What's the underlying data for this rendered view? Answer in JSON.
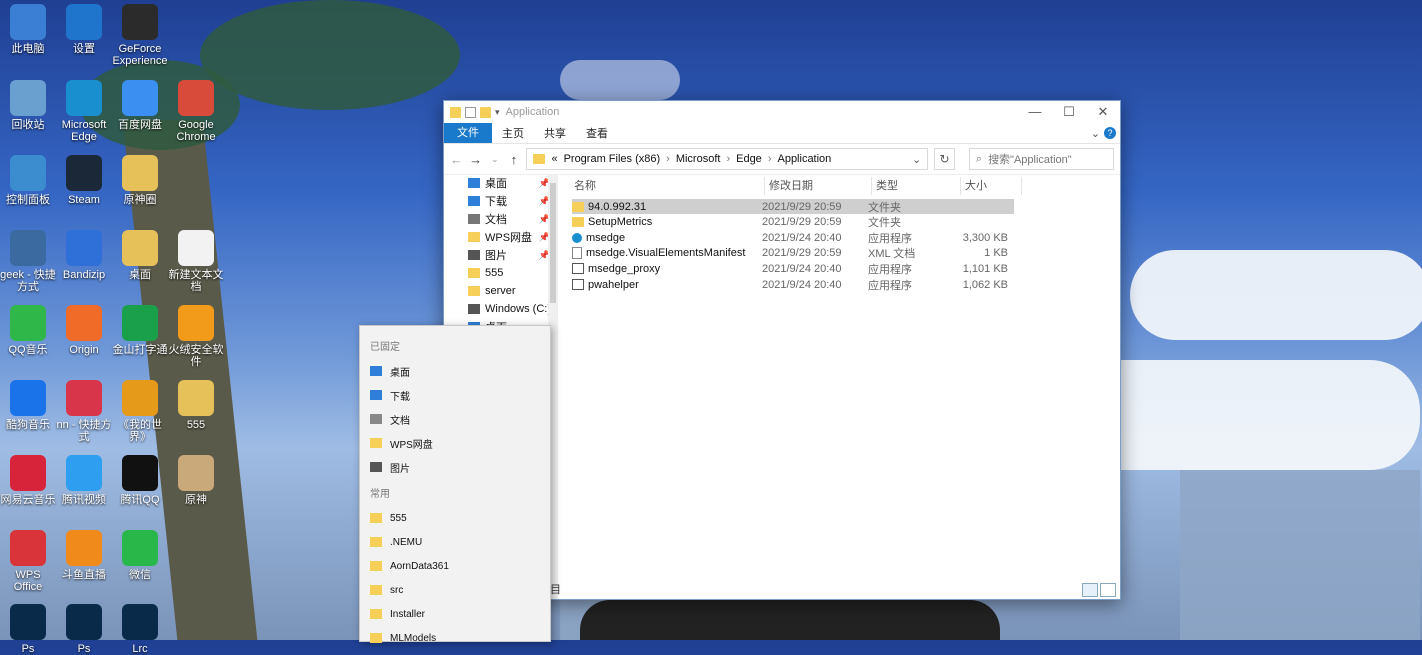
{
  "desktop": {
    "icons": [
      {
        "label": "此电脑",
        "color": "#3b7fd4"
      },
      {
        "label": "设置",
        "color": "#1f75cc"
      },
      {
        "label": "GeForce Experience",
        "color": "#2b2b2b"
      },
      {
        "label": "回收站",
        "color": "#6aa0d0"
      },
      {
        "label": "Microsoft Edge",
        "color": "#1a8fd0"
      },
      {
        "label": "百度网盘",
        "color": "#3b8ff0"
      },
      {
        "label": "Google Chrome",
        "color": "#d84a3a"
      },
      {
        "label": "控制面板",
        "color": "#3c8dcf"
      },
      {
        "label": "Steam",
        "color": "#1b2838"
      },
      {
        "label": "原神圈",
        "color": "#e6c15a"
      },
      {
        "label": "geek - 快捷方式",
        "color": "#3a6aa0"
      },
      {
        "label": "Bandizip",
        "color": "#2f6fd8"
      },
      {
        "label": "桌面",
        "color": "#e6c15a"
      },
      {
        "label": "新建文本文档",
        "color": "#f2f2f2"
      },
      {
        "label": "QQ音乐",
        "color": "#2fb74a"
      },
      {
        "label": "Origin",
        "color": "#f06a28"
      },
      {
        "label": "金山打字通",
        "color": "#1aa04a"
      },
      {
        "label": "火绒安全软件",
        "color": "#f29a1a"
      },
      {
        "label": "酷狗音乐",
        "color": "#1a73e8"
      },
      {
        "label": "nn - 快捷方式",
        "color": "#d8344a"
      },
      {
        "label": "《我的世界》",
        "color": "#e69a1a"
      },
      {
        "label": "555",
        "color": "#e6c15a"
      },
      {
        "label": "网易云音乐",
        "color": "#d8243a"
      },
      {
        "label": "腾讯视频",
        "color": "#2e9ef0"
      },
      {
        "label": "腾讯QQ",
        "color": "#111111"
      },
      {
        "label": "原神",
        "color": "#c9a87a"
      },
      {
        "label": "WPS Office",
        "color": "#d8343a"
      },
      {
        "label": "斗鱼直播",
        "color": "#f08a1a"
      },
      {
        "label": "微信",
        "color": "#2ab74a"
      },
      {
        "label": "Ps",
        "color": "#0a2a4a"
      },
      {
        "label": "Ps",
        "color": "#0a2a4a"
      },
      {
        "label": "Lrc",
        "color": "#0a2a4a"
      }
    ]
  },
  "explorer": {
    "title": "Application",
    "window_controls": {
      "minimize": "—",
      "maximize": "☐",
      "close": "✕"
    },
    "ribbon_tabs": [
      "文件",
      "主页",
      "共享",
      "查看"
    ],
    "breadcrumb": [
      "«",
      "Program Files (x86)",
      "Microsoft",
      "Edge",
      "Application"
    ],
    "search_placeholder": "搜索\"Application\"",
    "nav_items": [
      {
        "label": "桌面",
        "pinned": true,
        "color": "#2d7fd8"
      },
      {
        "label": "下载",
        "pinned": true,
        "color": "#2d7fd8"
      },
      {
        "label": "文档",
        "pinned": true,
        "color": "#777777"
      },
      {
        "label": "WPS网盘",
        "pinned": true,
        "color": "#f6cf58"
      },
      {
        "label": "图片",
        "pinned": true,
        "color": "#555555"
      },
      {
        "label": "555",
        "pinned": false,
        "color": "#f6cf58"
      },
      {
        "label": "server",
        "pinned": false,
        "color": "#f6cf58"
      },
      {
        "label": "Windows (C:)",
        "pinned": false,
        "color": "#555555"
      },
      {
        "label": "桌面",
        "pinned": false,
        "color": "#2d7fd8"
      }
    ],
    "columns": [
      "名称",
      "修改日期",
      "类型",
      "大小"
    ],
    "files": [
      {
        "name": "94.0.992.31",
        "date": "2021/9/29 20:59",
        "type": "文件夹",
        "size": "",
        "icon": "folder",
        "selected": true
      },
      {
        "name": "SetupMetrics",
        "date": "2021/9/29 20:59",
        "type": "文件夹",
        "size": "",
        "icon": "folder",
        "selected": false
      },
      {
        "name": "msedge",
        "date": "2021/9/24 20:40",
        "type": "应用程序",
        "size": "3,300 KB",
        "icon": "edge",
        "selected": false
      },
      {
        "name": "msedge.VisualElementsManifest",
        "date": "2021/9/29 20:59",
        "type": "XML 文档",
        "size": "1 KB",
        "icon": "doc",
        "selected": false
      },
      {
        "name": "msedge_proxy",
        "date": "2021/9/24 20:40",
        "type": "应用程序",
        "size": "1,101 KB",
        "icon": "app",
        "selected": false
      },
      {
        "name": "pwahelper",
        "date": "2021/9/24 20:40",
        "type": "应用程序",
        "size": "1,062 KB",
        "icon": "app",
        "selected": false
      }
    ],
    "status_fragment": "目"
  },
  "popup": {
    "pinned_header": "已固定",
    "pinned": [
      {
        "label": "桌面",
        "color": "#2d7fd8"
      },
      {
        "label": "下载",
        "color": "#2d7fd8"
      },
      {
        "label": "文档",
        "color": "#888888"
      },
      {
        "label": "WPS网盘",
        "color": "#f6cf58"
      },
      {
        "label": "图片",
        "color": "#555555"
      }
    ],
    "frequent_header": "常用",
    "frequent": [
      "555",
      ".NEMU",
      "AornData361",
      "src",
      "Installer",
      "MLModels"
    ]
  }
}
